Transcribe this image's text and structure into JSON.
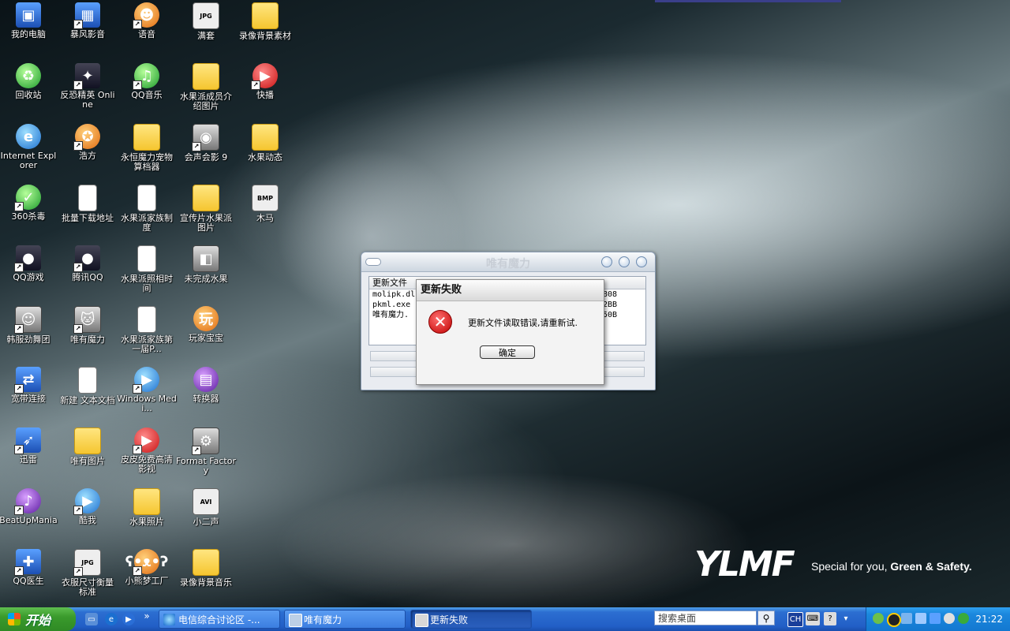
{
  "desktop": {
    "icons": [
      {
        "label": "我的电脑"
      },
      {
        "label": "回收站"
      },
      {
        "label": "Internet Explorer"
      },
      {
        "label": "360杀毒"
      },
      {
        "label": "QQ游戏"
      },
      {
        "label": "韩服劲舞团"
      },
      {
        "label": "宽带连接"
      },
      {
        "label": "迅雷"
      },
      {
        "label": "BeatUpMania"
      },
      {
        "label": "QQ医生"
      },
      {
        "label": "暴风影音"
      },
      {
        "label": "反恐精英 Online"
      },
      {
        "label": "浩方"
      },
      {
        "label": "批量下载地址"
      },
      {
        "label": "腾讯QQ"
      },
      {
        "label": "唯有魔力"
      },
      {
        "label": "新建 文本文档"
      },
      {
        "label": "唯有图片"
      },
      {
        "label": "酷我"
      },
      {
        "label": "衣服尺寸衡量标准"
      },
      {
        "label": "语音"
      },
      {
        "label": "QQ音乐"
      },
      {
        "label": "永恒魔力宠物算档器"
      },
      {
        "label": "水果派家族制度"
      },
      {
        "label": "水果派照相时间"
      },
      {
        "label": "水果派家族第一届P..."
      },
      {
        "label": "Windows Medi..."
      },
      {
        "label": "皮皮免费高清影视"
      },
      {
        "label": "水果照片"
      },
      {
        "label": "小熊梦工厂"
      },
      {
        "label": "满套"
      },
      {
        "label": "水果派成员介绍图片"
      },
      {
        "label": "会声会影 9"
      },
      {
        "label": "宣传片水果派图片"
      },
      {
        "label": "未完成水果"
      },
      {
        "label": "玩家宝宝"
      },
      {
        "label": "转换器"
      },
      {
        "label": "Format Factory"
      },
      {
        "label": "小二声"
      },
      {
        "label": "录像背景音乐"
      },
      {
        "label": "录像背景素材"
      },
      {
        "label": "快播"
      },
      {
        "label": "水果动态"
      },
      {
        "label": "木马"
      }
    ],
    "icon_glyphs": {
      "jpg": "JPG",
      "bmp": "BMP",
      "avi": "AVI",
      "wan": "玩"
    }
  },
  "brand": {
    "logo": "YLMF",
    "slogan_plain": "Special for you,",
    "slogan_bold": "Green & Safety."
  },
  "app_window": {
    "title": "唯有魔力",
    "list_header": "更新文件",
    "files": [
      {
        "name": "molipk.dll",
        "size": "808"
      },
      {
        "name": "pkml.exe",
        "size": "2BB"
      },
      {
        "name": "唯有魔力.",
        "size": "50B"
      }
    ]
  },
  "error_dialog": {
    "title": "更新失败",
    "message": "更新文件读取错误,请重新试.",
    "ok_label": "确定",
    "icon": "error-x-icon"
  },
  "taskbar": {
    "start_label": "开始",
    "tasks": [
      {
        "label": "电信综合讨论区 -..."
      },
      {
        "label": "唯有魔力"
      },
      {
        "label": "更新失败"
      }
    ],
    "search_placeholder": "搜索桌面",
    "lang": "CH",
    "clock": "21:22",
    "overflow": "»"
  }
}
